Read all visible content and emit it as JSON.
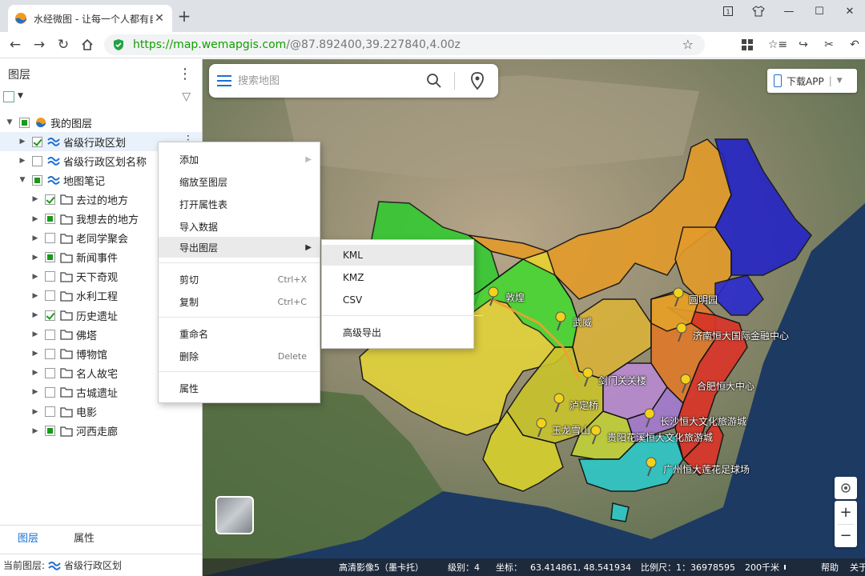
{
  "browser": {
    "tab_title": "水经微图 - 让每一个人都有自",
    "new_tab": "+",
    "url_host": "https://map.wemapgis.com",
    "url_path": "/@87.892400,39.227840,4.00z"
  },
  "panel": {
    "title": "图层",
    "layers": [
      {
        "label": "我的图层",
        "state": "partial",
        "level": 0
      },
      {
        "label": "省级行政区划",
        "state": "checked",
        "level": 1
      },
      {
        "label": "省级行政区划名称",
        "state": "unchecked",
        "level": 1
      },
      {
        "label": "地图笔记",
        "state": "partial",
        "level": 1
      },
      {
        "label": "去过的地方",
        "state": "checked",
        "level": 2
      },
      {
        "label": "我想去的地方",
        "state": "partial",
        "level": 2
      },
      {
        "label": "老同学聚会",
        "state": "unchecked",
        "level": 2
      },
      {
        "label": "新闻事件",
        "state": "partial",
        "level": 2
      },
      {
        "label": "天下奇观",
        "state": "unchecked",
        "level": 2
      },
      {
        "label": "水利工程",
        "state": "unchecked",
        "level": 2
      },
      {
        "label": "历史遗址",
        "state": "checked",
        "level": 2
      },
      {
        "label": "佛塔",
        "state": "unchecked",
        "level": 2
      },
      {
        "label": "博物馆",
        "state": "unchecked",
        "level": 2
      },
      {
        "label": "名人故宅",
        "state": "unchecked",
        "level": 2
      },
      {
        "label": "古城遗址",
        "state": "unchecked",
        "level": 2
      },
      {
        "label": "电影",
        "state": "unchecked",
        "level": 2
      },
      {
        "label": "河西走廊",
        "state": "partial",
        "level": 2
      }
    ],
    "tabs": [
      "图层",
      "属性"
    ],
    "current_layer_label": "当前图层:",
    "current_layer_value": "省级行政区划"
  },
  "search": {
    "placeholder": "搜索地图"
  },
  "download_app": "下载APP",
  "context_menu": {
    "items": [
      "添加",
      "缩放至图层",
      "打开属性表",
      "导入数据",
      "导出图层",
      "剪切",
      "复制",
      "重命名",
      "删除",
      "属性"
    ],
    "shortcuts": {
      "cut": "Ctrl+X",
      "copy": "Ctrl+C",
      "delete": "Delete"
    }
  },
  "export_submenu": [
    "KML",
    "KMZ",
    "CSV",
    "高级导出"
  ],
  "markers": [
    "敦煌",
    "武威",
    "圆明园",
    "济南恒大国际金融中心",
    "剑门关关楼",
    "合肥恒大中心",
    "泸定桥",
    "长沙恒大文化旅游城",
    "玉龙雪山",
    "贵阳花溪恒大文化旅游城",
    "广州恒大莲花足球场"
  ],
  "statusbar": {
    "imagery": "高清影像5（墨卡托）",
    "level_label": "级别：",
    "level": "4",
    "coord_label": "坐标：",
    "coord": "63.414861, 48.541934",
    "scale_label": "比例尺：",
    "scale": "1：36978595",
    "scale_bar": "200千米",
    "help": "帮助",
    "about": "关于"
  },
  "colors": {
    "accent": "#1e6fd0",
    "url_green": "#11a000",
    "check_green": "#1a9a1a"
  }
}
